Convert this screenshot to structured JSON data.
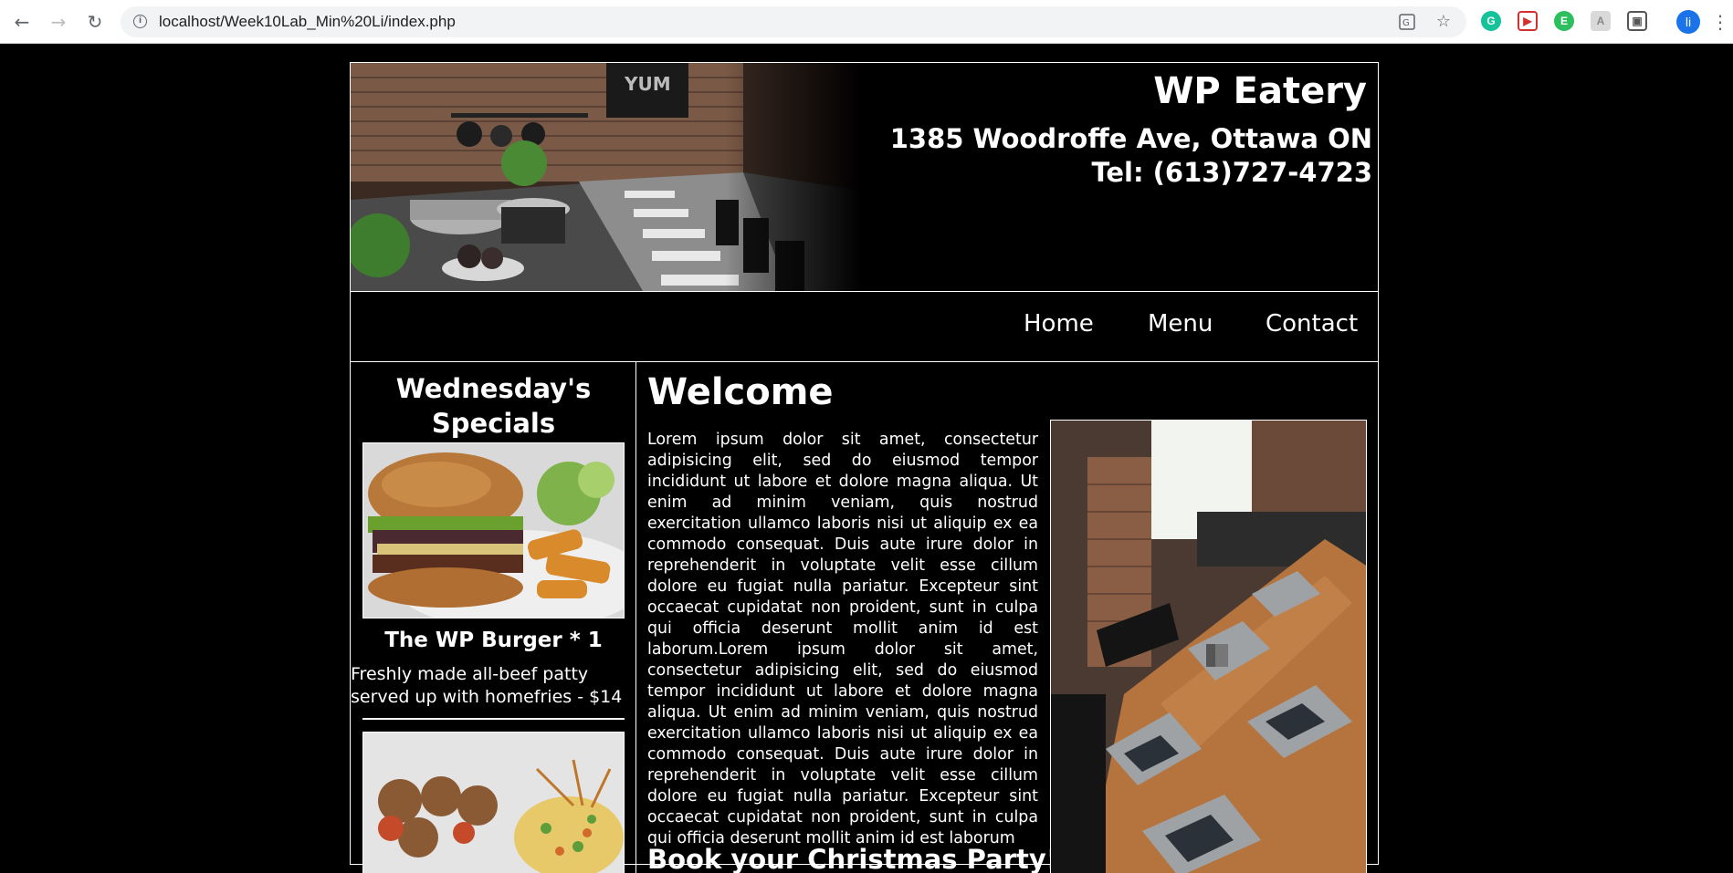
{
  "browser": {
    "url": "localhost/Week10Lab_Min%20Li/index.php",
    "avatar_letter": "li",
    "icons": [
      "back-icon",
      "forward-icon",
      "reload-icon",
      "info-icon",
      "translate-icon",
      "star-icon",
      "grammarly-icon",
      "video-extension-icon",
      "evernote-icon",
      "extension-icon",
      "screenshot-icon",
      "menu-icon"
    ]
  },
  "site": {
    "title": "WP Eatery",
    "address": "1385 Woodroffe Ave, Ottawa ON",
    "phone": "Tel: (613)727-4723"
  },
  "nav": {
    "items": [
      "Home",
      "Menu",
      "Contact"
    ]
  },
  "sidebar": {
    "title_line1": "Wednesday's",
    "title_line2": "Specials",
    "special1": {
      "name": "The WP Burger * 1",
      "description": "Freshly made all-beef patty served up with homefries - $14"
    }
  },
  "main": {
    "heading": "Welcome",
    "body": "Lorem ipsum dolor sit amet, consectetur adipisicing elit, sed do eiusmod tempor incididunt ut labore et dolore magna aliqua. Ut enim ad minim veniam, quis nostrud exercitation ullamco laboris nisi ut aliquip ex ea commodo consequat. Duis aute irure dolor in reprehenderit in voluptate velit esse cillum dolore eu fugiat nulla pariatur. Excepteur sint occaecat cupidatat non proident, sunt in culpa qui officia deserunt mollit anim id est laborum.Lorem ipsum dolor sit amet, consectetur adipisicing elit, sed do eiusmod tempor incididunt ut labore et dolore magna aliqua. Ut enim ad minim veniam, quis nostrud exercitation ullamco laboris nisi ut aliquip ex ea commodo consequat. Duis aute irure dolor in reprehenderit in voluptate velit esse cillum dolore eu fugiat nulla pariatur. Excepteur sint occaecat cupidatat non proident, sunt in culpa qui officia deserunt mollit anim id est laborum",
    "subheading": "Book your Christmas Party!"
  }
}
